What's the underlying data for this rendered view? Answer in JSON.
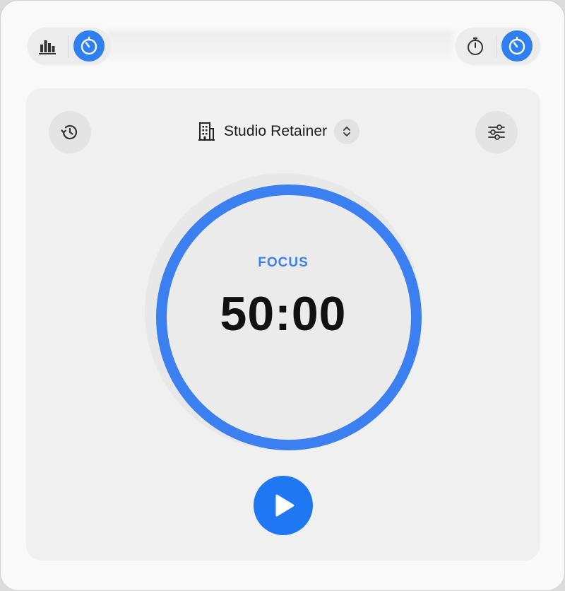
{
  "toolbar": {
    "left_buttons": [
      {
        "icon": "bar-chart-icon",
        "active": false
      },
      {
        "icon": "timer-icon",
        "active": true
      }
    ],
    "right_buttons": [
      {
        "icon": "stopwatch-icon",
        "active": false
      },
      {
        "icon": "timer-icon",
        "active": true
      }
    ]
  },
  "header": {
    "project_name": "Studio Retainer",
    "project_icon": "building-icon",
    "history_icon": "history-icon",
    "settings_icon": "sliders-icon"
  },
  "timer": {
    "phase": "FOCUS",
    "time": "50:00",
    "progress": 1.0
  },
  "controls": {
    "play_icon": "play-icon"
  },
  "colors": {
    "accent": "#3b7ff0",
    "accent_button": "#1f78f2",
    "text": "#1c1c1e"
  }
}
